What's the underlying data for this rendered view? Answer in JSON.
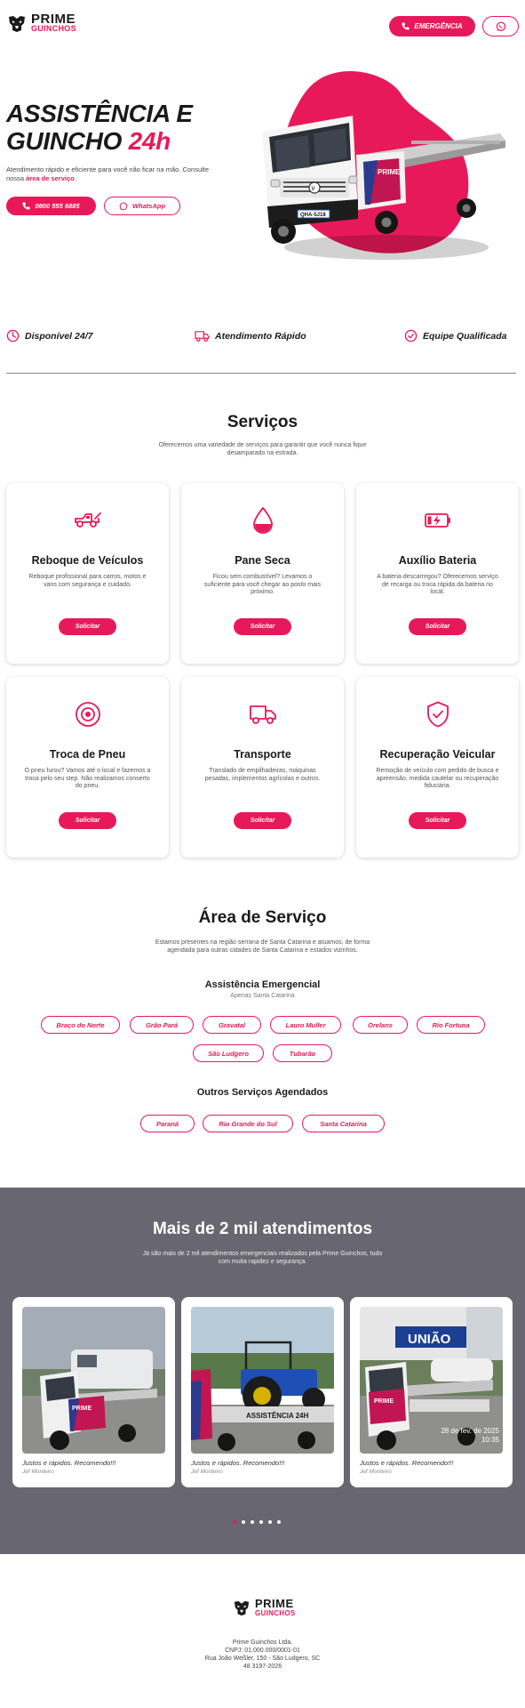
{
  "brand": {
    "line1": "PRIME",
    "line2": "GUINCHOS"
  },
  "header": {
    "emergency_label": "EMERGÊNCIA"
  },
  "hero": {
    "title_line1": "ASSISTÊNCIA E",
    "title_line2_a": "GUINCHO ",
    "title_line2_b": "24h",
    "subtitle_a": "Atendimento rápido e eficiente para você não ficar na mão. Consulte nossa ",
    "subtitle_link": "área de serviço",
    "subtitle_b": ".",
    "phone_label": "0800 555 6885",
    "whatsapp_label": "WhatsApp",
    "truck_plate": "QHA-5J18",
    "truck_brand": "PRIME"
  },
  "features": [
    "Disponível 24/7",
    "Atendimento Rápido",
    "Equipe Qualificada"
  ],
  "services": {
    "title": "Serviços",
    "subtitle": "Oferecemos uma variedade de serviços para garantir que você nunca fique desamparado na estrada.",
    "button_label": "Solicitar",
    "items": [
      {
        "icon": "tow-truck-icon",
        "title": "Reboque de Veículos",
        "desc": "Reboque profissional para carros, motos e vans com segurança e cuidado."
      },
      {
        "icon": "fuel-drop-icon",
        "title": "Pane Seca",
        "desc": "Ficou sem combustível? Levamos o suficiente para você chegar ao posto mais próximo."
      },
      {
        "icon": "battery-charging-icon",
        "title": "Auxílio Bateria",
        "desc": "A bateria descarregou? Oferecemos serviço de recarga ou troca rápida da bateria no local."
      },
      {
        "icon": "tire-icon",
        "title": "Troca de Pneu",
        "desc": "O pneu furou? Vamos até o local e fazemos a troca pelo seu step. Não realizamos conserto do pneu."
      },
      {
        "icon": "truck-icon",
        "title": "Transporte",
        "desc": "Translado de empilhadeiras, máquinas pesadas, implementos agrícolas e outros."
      },
      {
        "icon": "shield-check-icon",
        "title": "Recuperação Veicular",
        "desc": "Remoção de veículo com pedido de busca e apreensão, medida cautelar ou recuperação fiduciária."
      }
    ]
  },
  "area": {
    "title": "Área de Serviço",
    "subtitle": "Estamos presentes na região serrana de Santa Catarina e atuamos, de forma agendada para outras cidades de Santa Catarina e estados vizinhos.",
    "emergency_title": "Assistência Emergencial",
    "emergency_note": "Apenas Santa Catarina",
    "emergency_cities": [
      "Braço do Norte",
      "Grão Pará",
      "Gravatal",
      "Lauro Muller",
      "Orelans",
      "Rio Fortuna",
      "São Ludgero",
      "Tubarão"
    ],
    "scheduled_title": "Outros Serviços Agendados",
    "scheduled_regions": [
      "Paraná",
      "Rio Grande do Sul",
      "Santa Catarina"
    ]
  },
  "testimonials": {
    "title": "Mais de 2 mil atendimentos",
    "subtitle": "Já são mais de 2 mil atendimentos emergenciais realizados pela Prime Guinchos, tudo com muita rapidez e segurança.",
    "items": [
      {
        "quote": "Justos e rápidos. Recomendo!!!",
        "author": "Jef Monteiro",
        "photo": "photo-van-tow"
      },
      {
        "quote": "Justos e rápidos. Recomendo!!!",
        "author": "Jef Monteiro",
        "photo": "photo-tractor-tow",
        "banner": "ASSISTÊNCIA 24H"
      },
      {
        "quote": "Justos e rápidos. Recomendo!!!",
        "author": "Jef Monteiro",
        "photo": "photo-car-tow",
        "sign": "UNIÃO",
        "stamp_date": "28 de fev. de 2025",
        "stamp_time": "10:35"
      }
    ],
    "dot_count": 6,
    "active_dot": 0
  },
  "footer": {
    "company": "Prime Guinchos Ltda.",
    "cnpj": "CNPJ: 01.000.000/0001-01",
    "address": "Rua João Weßler, 150 - São Ludgero, SC",
    "phone": "48 3197-2026"
  },
  "colors": {
    "accent": "#e8195a",
    "dark": "#1a1a1a",
    "band": "#686670"
  }
}
